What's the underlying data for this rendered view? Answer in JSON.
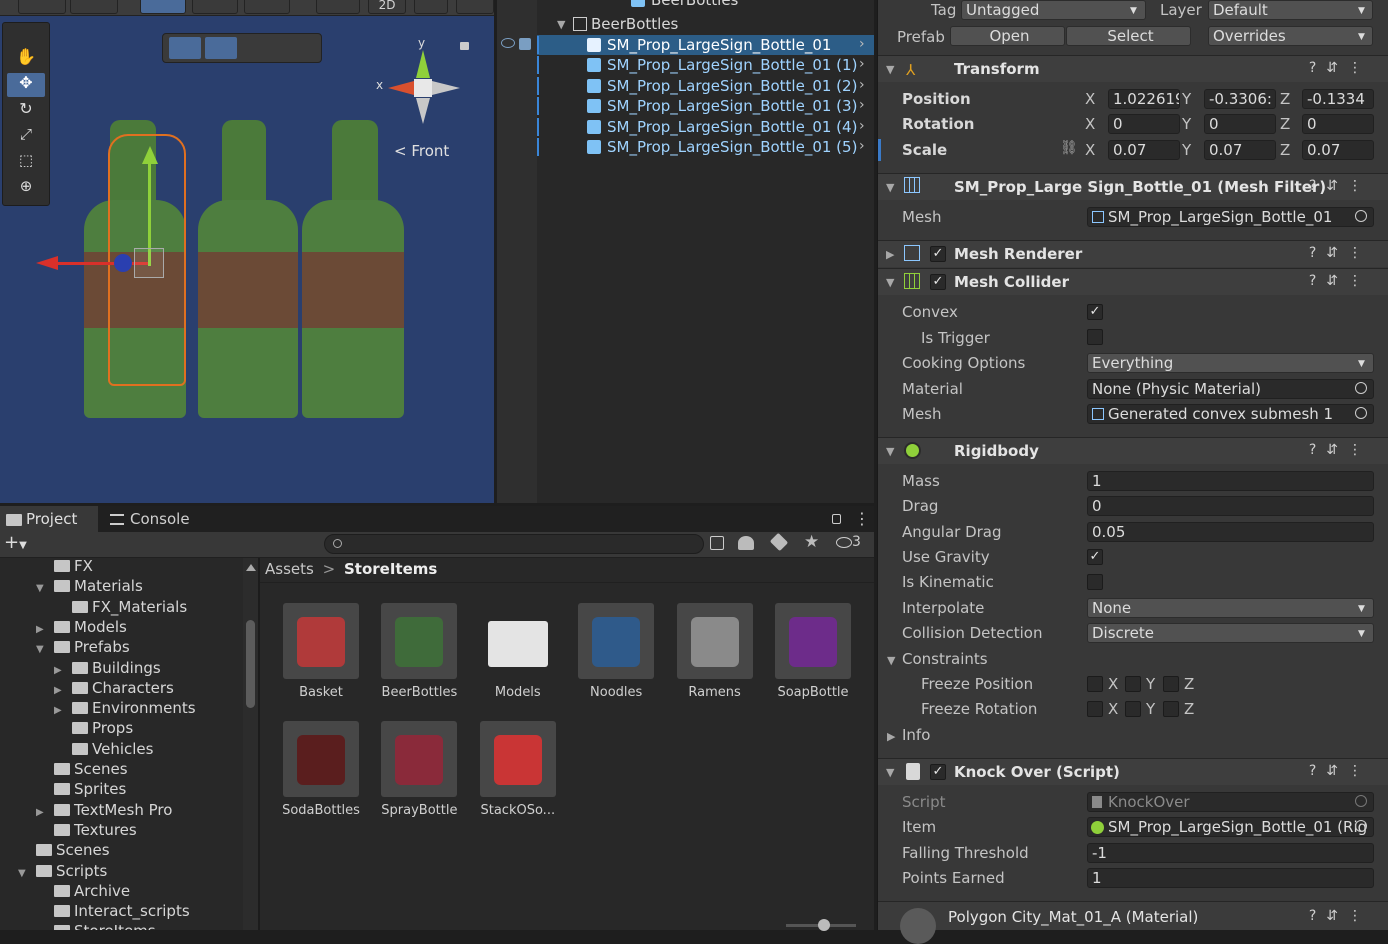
{
  "scene": {
    "toolbar_2d": "2D",
    "gizmo": {
      "y": "y",
      "x": "x",
      "view": "< Front"
    }
  },
  "hierarchy": {
    "top_partial": "BeerBottles",
    "parent": "BeerBottles",
    "items": [
      "SM_Prop_LargeSign_Bottle_01",
      "SM_Prop_LargeSign_Bottle_01 (1)",
      "SM_Prop_LargeSign_Bottle_01 (2)",
      "SM_Prop_LargeSign_Bottle_01 (3)",
      "SM_Prop_LargeSign_Bottle_01 (4)",
      "SM_Prop_LargeSign_Bottle_01 (5)"
    ]
  },
  "project": {
    "tabs": [
      "Project",
      "Console"
    ],
    "hidden_count": "3",
    "breadcrumb": {
      "root": "Assets",
      "sep": ">",
      "current": "StoreItems"
    },
    "tree": [
      {
        "label": "FX",
        "indent": 0,
        "arrow": ""
      },
      {
        "label": "Materials",
        "indent": 0,
        "arrow": "▼"
      },
      {
        "label": "FX_Materials",
        "indent": 1,
        "arrow": ""
      },
      {
        "label": "Models",
        "indent": 0,
        "arrow": "▶"
      },
      {
        "label": "Prefabs",
        "indent": 0,
        "arrow": "▼"
      },
      {
        "label": "Buildings",
        "indent": 1,
        "arrow": "▶"
      },
      {
        "label": "Characters",
        "indent": 1,
        "arrow": "▶"
      },
      {
        "label": "Environments",
        "indent": 1,
        "arrow": "▶"
      },
      {
        "label": "Props",
        "indent": 1,
        "arrow": ""
      },
      {
        "label": "Vehicles",
        "indent": 1,
        "arrow": ""
      },
      {
        "label": "Scenes",
        "indent": 0,
        "arrow": ""
      },
      {
        "label": "Sprites",
        "indent": 0,
        "arrow": ""
      },
      {
        "label": "TextMesh Pro",
        "indent": 0,
        "arrow": "▶"
      },
      {
        "label": "Textures",
        "indent": 0,
        "arrow": ""
      },
      {
        "label": "Scenes",
        "indent": -1,
        "arrow": ""
      },
      {
        "label": "Scripts",
        "indent": -1,
        "arrow": "▼"
      },
      {
        "label": "Archive",
        "indent": 0,
        "arrow": ""
      },
      {
        "label": "Interact_scripts",
        "indent": 0,
        "arrow": ""
      },
      {
        "label": "StoreItems",
        "indent": 0,
        "arrow": ""
      }
    ],
    "assets": [
      {
        "label": "Basket",
        "color": "#b03a3a"
      },
      {
        "label": "BeerBottles",
        "color": "#3f6b3a"
      },
      {
        "label": "Models",
        "color": "#e4e4e4"
      },
      {
        "label": "Noodles",
        "color": "#2f5a8a"
      },
      {
        "label": "Ramens",
        "color": "#8a8a8a"
      },
      {
        "label": "SoapBottle",
        "color": "#6d2c8a"
      },
      {
        "label": "SodaBottles",
        "color": "#5a1e1e"
      },
      {
        "label": "SprayBottle",
        "color": "#8a2a3a"
      },
      {
        "label": "StackOSo...",
        "color": "#c93535"
      }
    ]
  },
  "inspector": {
    "tag_label": "Tag",
    "tag_value": "Untagged",
    "layer_label": "Layer",
    "layer_value": "Default",
    "prefab_label": "Prefab",
    "open": "Open",
    "select": "Select",
    "overrides": "Overrides",
    "transform": {
      "title": "Transform",
      "position": {
        "label": "Position",
        "x": "1.022619",
        "y": "-0.3306:",
        "z": "-0.1334"
      },
      "rotation": {
        "label": "Rotation",
        "x": "0",
        "y": "0",
        "z": "0"
      },
      "scale": {
        "label": "Scale",
        "x": "0.07",
        "y": "0.07",
        "z": "0.07"
      }
    },
    "mesh_filter": {
      "title": "SM_Prop_Large Sign_Bottle_01 (Mesh Filter)",
      "mesh_label": "Mesh",
      "mesh_value": "SM_Prop_LargeSign_Bottle_01"
    },
    "mesh_renderer": {
      "title": "Mesh Renderer"
    },
    "mesh_collider": {
      "title": "Mesh Collider",
      "convex": "Convex",
      "is_trigger": "Is Trigger",
      "cooking_label": "Cooking Options",
      "cooking_value": "Everything",
      "material_label": "Material",
      "material_value": "None (Physic Material)",
      "mesh_label": "Mesh",
      "mesh_value": "Generated convex submesh 1"
    },
    "rigidbody": {
      "title": "Rigidbody",
      "mass_label": "Mass",
      "mass": "1",
      "drag_label": "Drag",
      "drag": "0",
      "ang_label": "Angular Drag",
      "ang": "0.05",
      "gravity_label": "Use Gravity",
      "kinematic_label": "Is Kinematic",
      "interp_label": "Interpolate",
      "interp": "None",
      "coll_label": "Collision Detection",
      "coll": "Discrete",
      "constraints": "Constraints",
      "freeze_pos": "Freeze Position",
      "freeze_rot": "Freeze Rotation",
      "axes": [
        "X",
        "Y",
        "Z"
      ],
      "info": "Info"
    },
    "knock": {
      "title": "Knock Over (Script)",
      "script_label": "Script",
      "script": "KnockOver",
      "item_label": "Item",
      "item": "SM_Prop_LargeSign_Bottle_01 (Rig",
      "fall_label": "Falling Threshold",
      "fall": "-1",
      "points_label": "Points Earned",
      "points": "1"
    },
    "material": {
      "title": "Polygon City_Mat_01_A (Material)"
    }
  }
}
